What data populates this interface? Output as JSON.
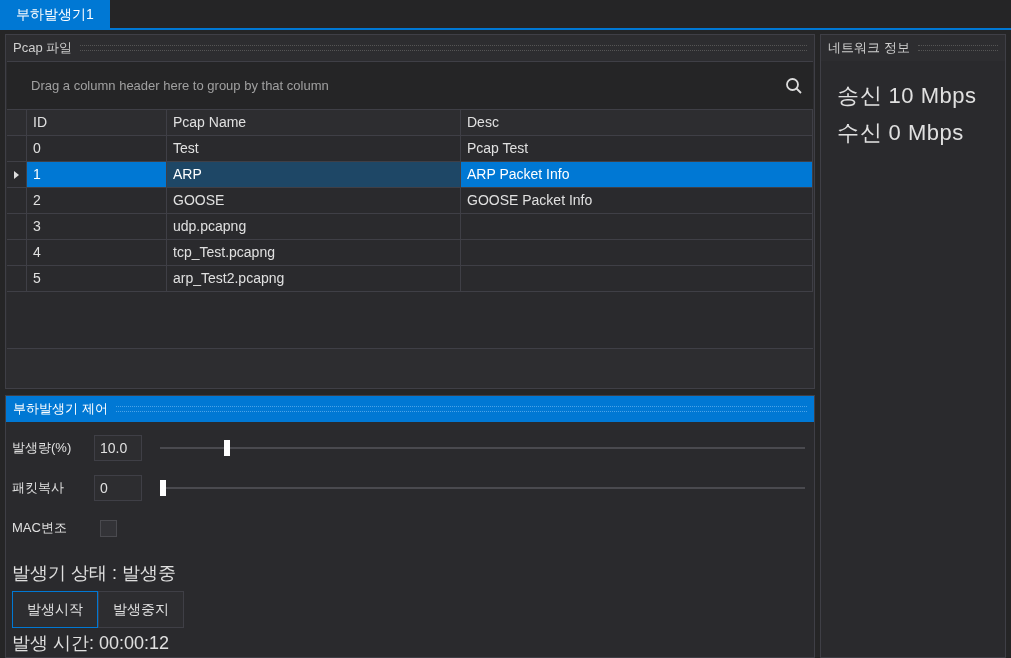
{
  "tabs": [
    {
      "label": "부하발생기1",
      "selected": true
    }
  ],
  "pcap_panel": {
    "title": "Pcap 파일",
    "group_panel": {
      "placeholder": "Drag a column header here to group by that column"
    },
    "table": {
      "columns": [
        {
          "label": "ID",
          "focused": false
        },
        {
          "label": "Pcap Name",
          "focused": true
        },
        {
          "label": "Desc",
          "focused": false
        }
      ],
      "rows": [
        {
          "cells": [
            "0",
            "Test",
            "Pcap Test"
          ],
          "selected": false
        },
        {
          "cells": [
            "1",
            "ARP",
            "ARP Packet Info"
          ],
          "selected": true
        },
        {
          "cells": [
            "2",
            "GOOSE",
            "GOOSE Packet Info"
          ],
          "selected": false
        },
        {
          "cells": [
            "3",
            "udp.pcapng",
            ""
          ],
          "selected": false
        },
        {
          "cells": [
            "4",
            "tcp_Test.pcapng",
            ""
          ],
          "selected": false
        },
        {
          "cells": [
            "5",
            "arp_Test2.pcapng",
            ""
          ],
          "selected": false
        }
      ]
    }
  },
  "control_panel": {
    "title": "부하발생기 제어",
    "active": true,
    "settings": [
      {
        "kind": "slider",
        "label": "발생량(%)",
        "value": "10.0",
        "level": 0.1
      },
      {
        "kind": "slider",
        "label": "패킷복사",
        "value": "0",
        "level": 0
      },
      {
        "kind": "checkbox",
        "label": "MAC변조",
        "checked": false
      }
    ],
    "status": "발생기 상태 : 발생중",
    "buttons": [
      {
        "label": "발생시작",
        "focused": true
      },
      {
        "label": "발생중지",
        "focused": false
      }
    ],
    "elapsed": "발생 시간: 00:00:12"
  },
  "network_panel": {
    "title": "네트워크 정보",
    "lines": [
      "송신 10 Mbps",
      "수신 0 Mbps"
    ]
  }
}
